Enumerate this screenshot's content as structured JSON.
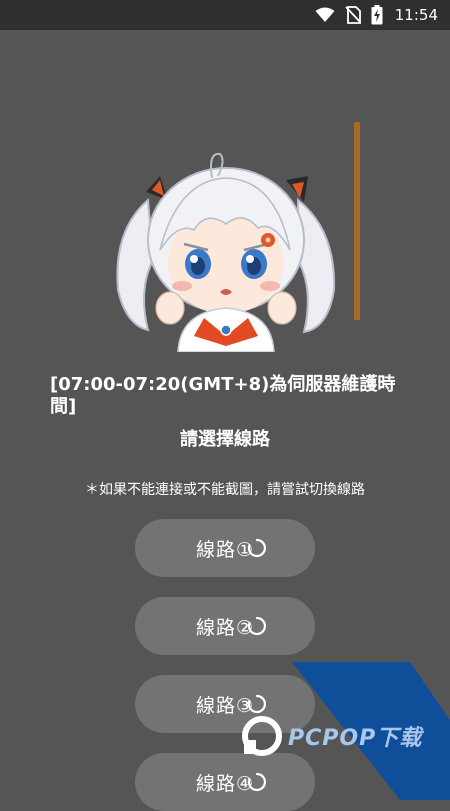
{
  "status_bar": {
    "time": "11:54",
    "icons": [
      "wifi-icon",
      "no-sim-icon",
      "battery-charging-icon"
    ]
  },
  "notice": "[07:00-07:20(GMT+8)為伺服器維護時間]",
  "title": "請選擇線路",
  "hint": "＊如果不能連接或不能截圖，請嘗試切換線路",
  "lines": [
    {
      "label": "線路①"
    },
    {
      "label": "線路②"
    },
    {
      "label": "線路③"
    },
    {
      "label": "線路④"
    }
  ],
  "watermark": {
    "text": "PCPOP下载",
    "brand_color": "#0f4f9a"
  },
  "colors": {
    "background": "#555555",
    "status_bar": "#2f2f2f",
    "button": "#737373",
    "accent_line": "#a8672d"
  }
}
